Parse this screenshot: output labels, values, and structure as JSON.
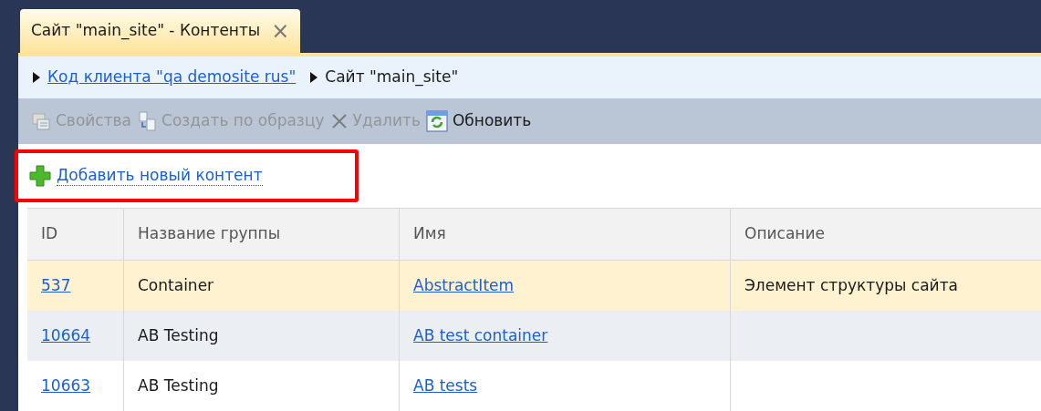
{
  "tab": {
    "title": "Сайт \"main_site\" - Контенты",
    "selected": true,
    "close": "×"
  },
  "breadcrumbs": [
    {
      "label": "Код клиента \"qa demosite rus\"",
      "link": true
    },
    {
      "label": "Сайт \"main_site\"",
      "link": false
    }
  ],
  "toolbar": [
    {
      "label": "Свойства",
      "kind": "properties",
      "disabled": true
    },
    {
      "label": "Создать по образцу",
      "kind": "copy",
      "disabled": true
    },
    {
      "label": "Удалить",
      "kind": "delete",
      "disabled": true
    },
    {
      "label": "Обновить",
      "kind": "refresh",
      "disabled": false
    }
  ],
  "add_link": {
    "label": "Добавить новый контент",
    "highlighted": true
  },
  "table": {
    "columns": [
      "ID",
      "Название группы",
      "Имя",
      "Описание"
    ],
    "rows": [
      {
        "id": "537",
        "group": "Container",
        "name": "AbstractItem",
        "description": "Элемент структуры сайта",
        "selected": true
      },
      {
        "id": "10664",
        "group": "AB Testing",
        "name": "AB test container",
        "selected": false
      },
      {
        "id": "10663",
        "group": "AB Testing",
        "name": "AB tests",
        "selected": false
      }
    ]
  }
}
